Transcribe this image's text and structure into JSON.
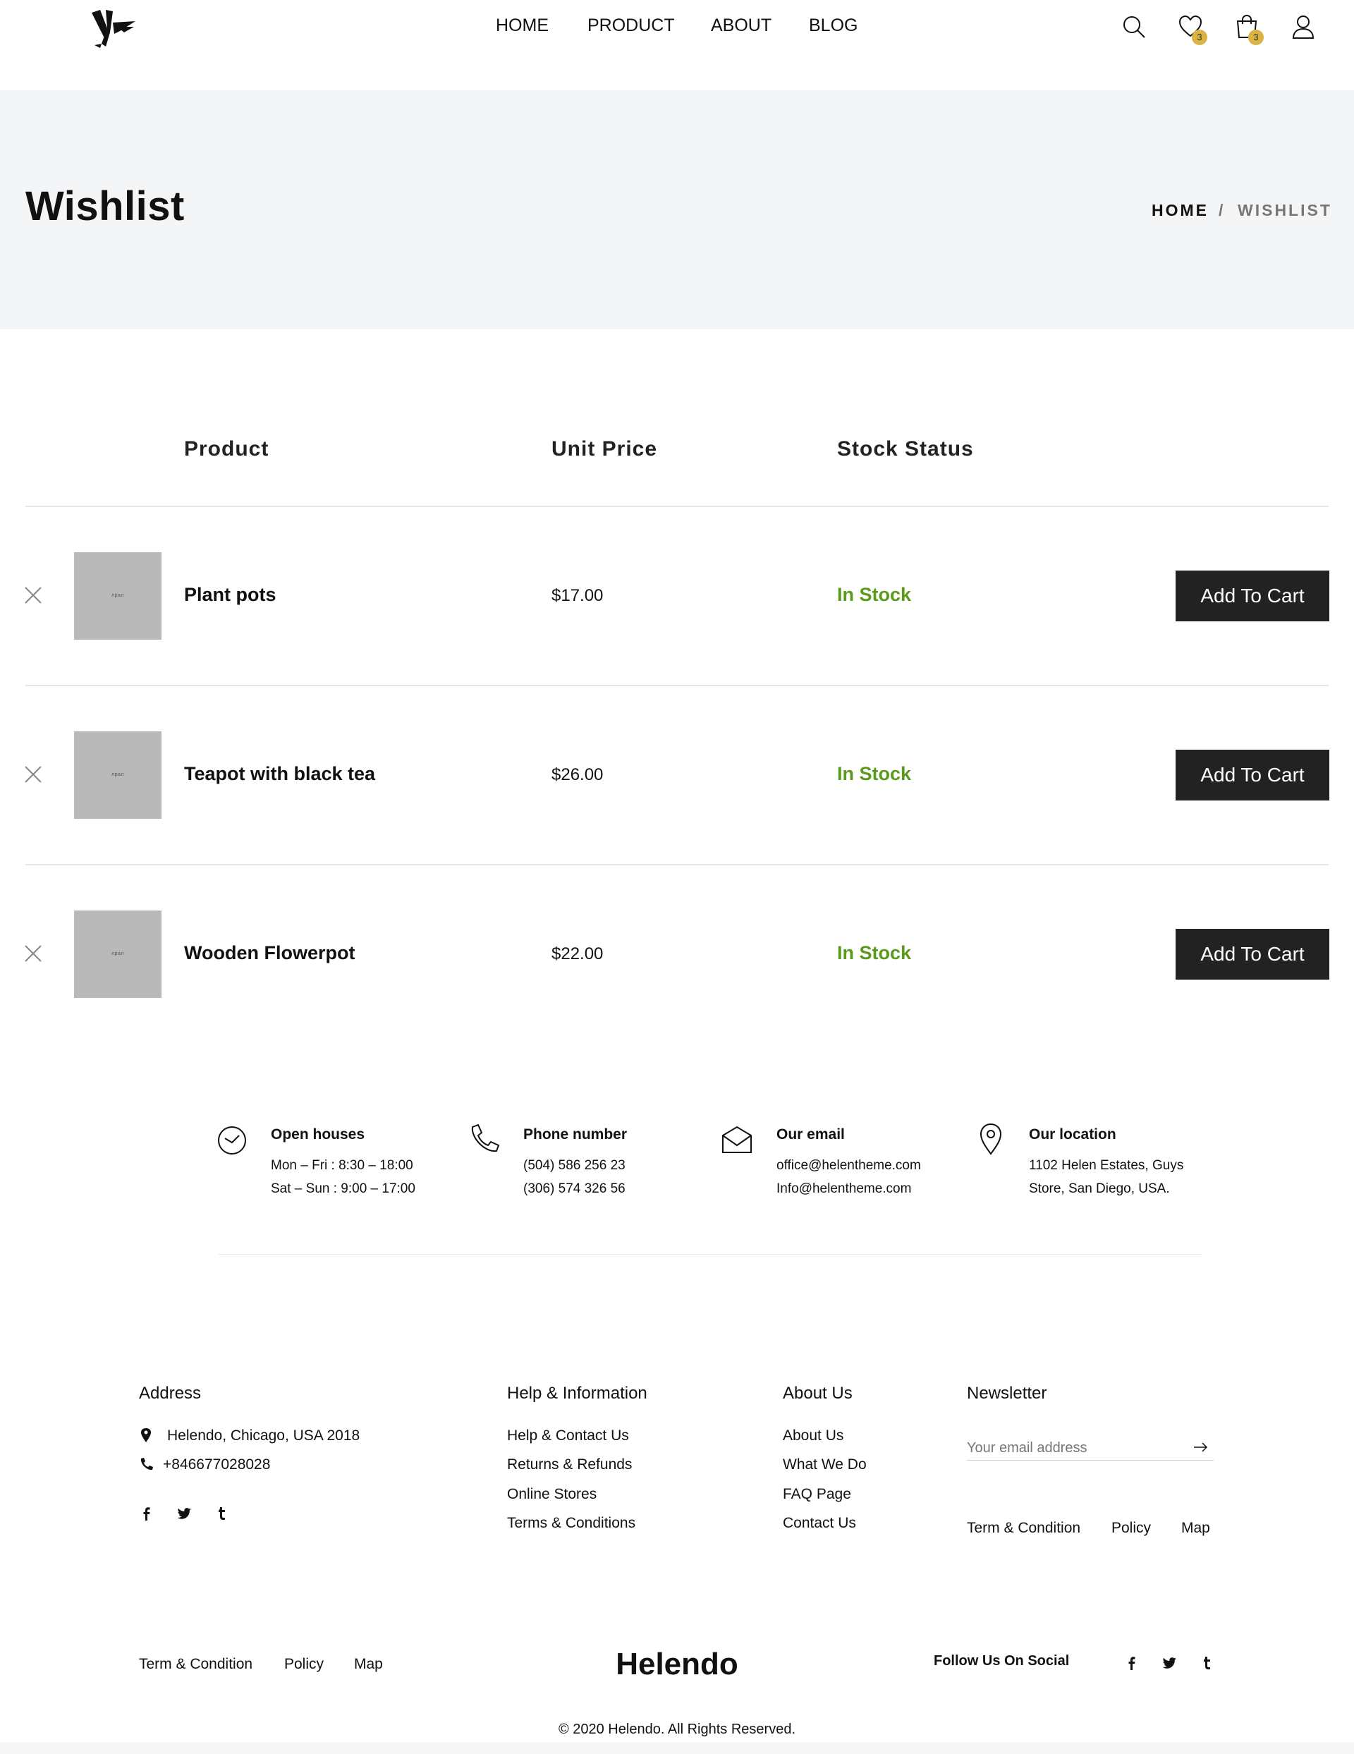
{
  "header": {
    "nav": [
      "HOME",
      "PRODUCT",
      "ABOUT",
      "BLOG"
    ],
    "wishlist_count": "3",
    "cart_count": "3",
    "badge_color": "#d9b443"
  },
  "banner": {
    "title": "Wishlist",
    "breadcrumb_home": "HOME",
    "breadcrumb_sep": "/",
    "breadcrumb_current": "WISHLIST"
  },
  "table": {
    "headers": {
      "product": "Product",
      "price": "Unit Price",
      "stock": "Stock Status"
    },
    "rows": [
      {
        "thumb_text": "лрал",
        "name": "Plant pots",
        "price": "$17.00",
        "stock": "In Stock",
        "action": "Add To Cart"
      },
      {
        "thumb_text": "лрал",
        "name": "Teapot with black tea",
        "price": "$26.00",
        "stock": "In Stock",
        "action": "Add To Cart"
      },
      {
        "thumb_text": "лрал",
        "name": "Wooden Flowerpot",
        "price": "$22.00",
        "stock": "In Stock",
        "action": "Add To Cart"
      }
    ],
    "stock_color": "#5a9a1a"
  },
  "contact": {
    "hours": {
      "title": "Open houses",
      "line1": "Mon – Fri : 8:30 – 18:00",
      "line2": "Sat – Sun : 9:00 – 17:00"
    },
    "phone": {
      "title": "Phone number",
      "line1": "(504) 586 256 23",
      "line2": "(306) 574 326 56"
    },
    "email": {
      "title": "Our email",
      "line1": "office@helentheme.com",
      "line2": "Info@helentheme.com"
    },
    "location": {
      "title": "Our location",
      "line1": "1102 Helen Estates, Guys",
      "line2": "Store, San Diego, USA."
    }
  },
  "footer": {
    "address": {
      "title": "Address",
      "line1": "Helendo, Chicago, USA 2018",
      "line2": "+846677028028"
    },
    "help": {
      "title": "Help & Information",
      "links": [
        "Help & Contact Us",
        "Returns & Refunds",
        "Online Stores",
        "Terms & Conditions"
      ]
    },
    "about": {
      "title": "About Us",
      "links": [
        "About Us",
        "What We Do",
        "FAQ Page",
        "Contact Us"
      ]
    },
    "newsletter": {
      "title": "Newsletter",
      "placeholder": "Your email address",
      "links": [
        "Term & Condition",
        "Policy",
        "Map"
      ]
    },
    "bottom_links": [
      "Term & Condition",
      "Policy",
      "Map"
    ],
    "brand": "Helendo",
    "follow": "Follow Us On Social",
    "copyright": "© 2020 Helendo. All Rights Reserved."
  }
}
